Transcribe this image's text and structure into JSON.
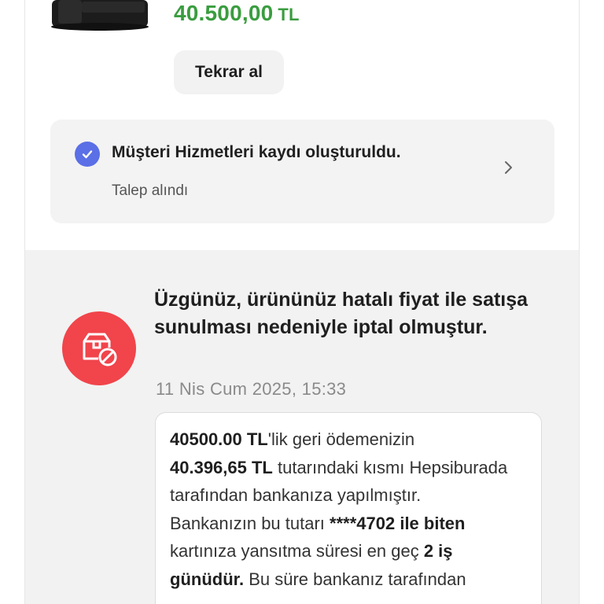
{
  "product": {
    "price_amount": "40.500,00",
    "price_currency": "TL",
    "rebuy_label": "Tekrar al"
  },
  "support_record": {
    "title": "Müşteri Hizmetleri kaydı oluşturuldu.",
    "status": "Talep alındı"
  },
  "cancellation": {
    "headline": "Üzgünüz, ürününüz hatalı fiyat ile satışa sunulması nedeniyle iptal olmuştur.",
    "date": "11 Nis Cum 2025, 15:33",
    "message": {
      "refund_total": "40500.00 TL",
      "t1": "'lik geri ödemenizin",
      "refund_partial": "40.396,65 TL",
      "t2": " tutarındaki kısmı Hepsiburada tarafından bankanıza yapılmıştır.",
      "t3": "Bankanızın bu tutarı ",
      "card_ending": "****4702 ile biten",
      "t4": " kartınıza yansıtma süresi en geç ",
      "duration": "2 iş günüdür.",
      "t5": " Bu süre bankanız tarafından"
    }
  },
  "colors": {
    "price_green": "#3a9d3f",
    "check_blue": "#5b6fe6",
    "cancel_red": "#f1444b"
  }
}
